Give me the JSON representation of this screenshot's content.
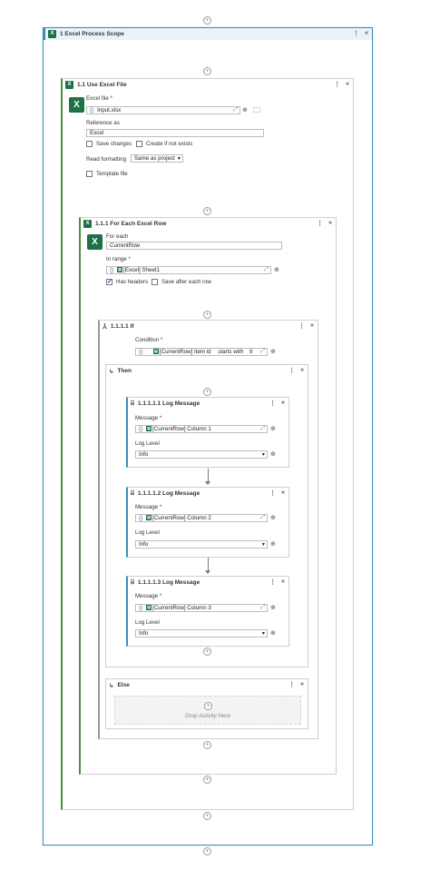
{
  "scope": {
    "title": "1 Excel Process Scope"
  },
  "use_excel": {
    "title": "1.1 Use Excel File",
    "excel_file_label": "Excel file",
    "excel_file_value": "Input.xlsx",
    "reference_label": "Reference as",
    "reference_value": "Excel",
    "save_changes_label": "Save changes",
    "create_if_not_exists_label": "Create if not exists",
    "read_formatting_label": "Read formatting",
    "read_formatting_value": "Same as project",
    "template_file_label": "Template file"
  },
  "for_each": {
    "title": "1.1.1 For Each Excel Row",
    "for_each_label": "For each",
    "for_each_value": "CurrentRow",
    "in_range_label": "In range",
    "in_range_value": "[Excel] Sheet1",
    "has_headers_label": "Has headers",
    "save_after_label": "Save after each row"
  },
  "if_block": {
    "title": "1.1.1.1 If",
    "condition_label": "Condition",
    "condition_value": "[CurrentRow] Item id",
    "condition_operator": "starts with",
    "condition_operand": "9"
  },
  "then": {
    "title": "Then"
  },
  "else": {
    "title": "Else",
    "drop_text": "Drop Activity Here"
  },
  "log_messages": [
    {
      "title": "1.1.1.1.1 Log Message",
      "message_label": "Message",
      "message_value": "[CurrentRow] Column 1",
      "level_label": "Log Level",
      "level_value": "Info"
    },
    {
      "title": "1.1.1.1.2 Log Message",
      "message_label": "Message",
      "message_value": "[CurrentRow] Column 2",
      "level_label": "Log Level",
      "level_value": "Info"
    },
    {
      "title": "1.1.1.1.3 Log Message",
      "message_label": "Message",
      "message_value": "[CurrentRow] Column 3",
      "level_label": "Log Level",
      "level_value": "Info"
    }
  ],
  "icons": {
    "more": "more-vertical-icon",
    "collapse": "collapse-up-icon",
    "add": "plus-icon"
  },
  "colors": {
    "accent": "#3a8fb7",
    "excel_green": "#1e7145"
  }
}
